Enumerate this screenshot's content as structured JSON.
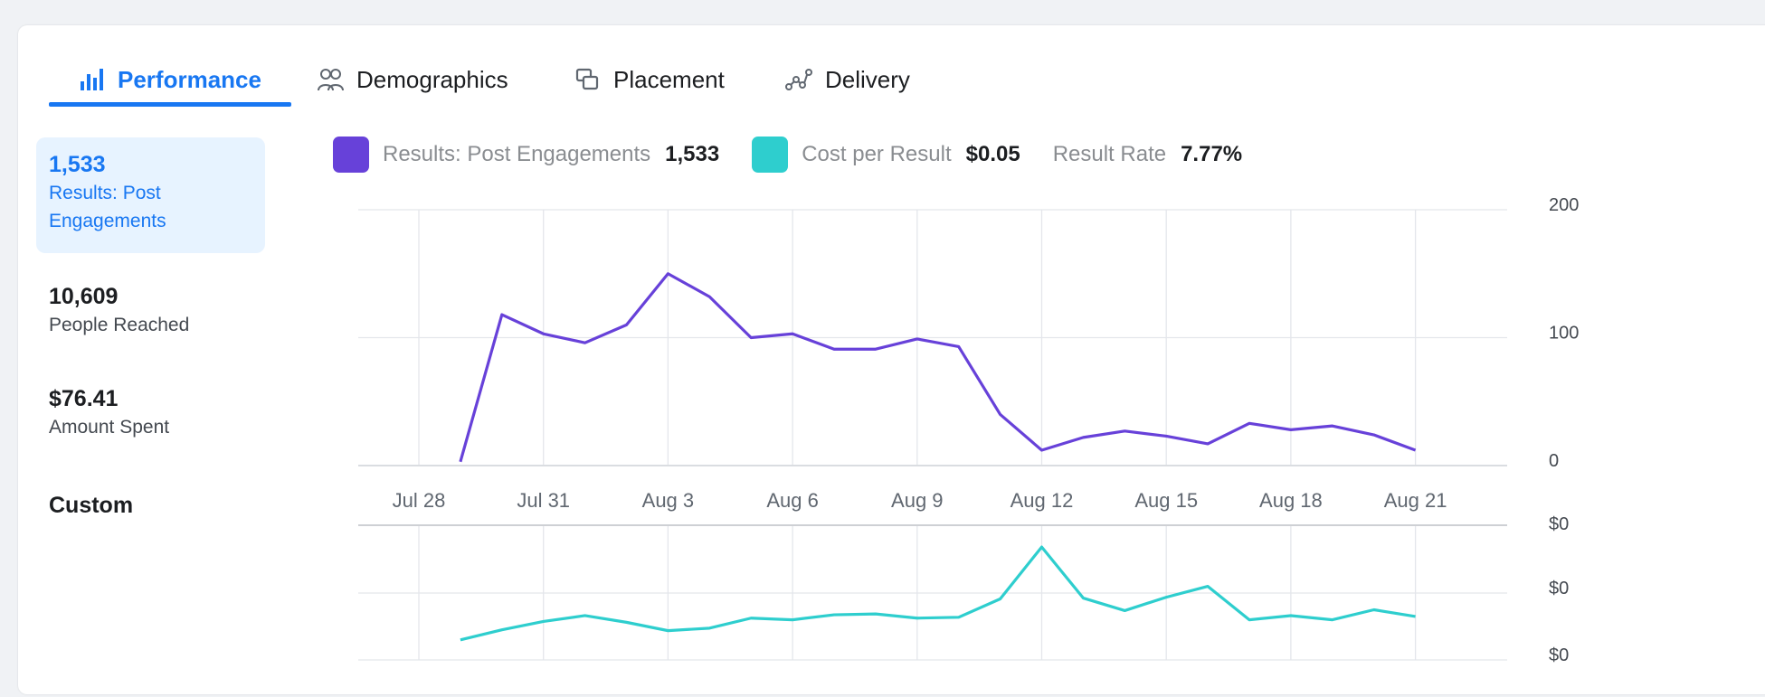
{
  "tabs": [
    {
      "label": "Performance",
      "icon": "bar-chart-icon",
      "active": true
    },
    {
      "label": "Demographics",
      "icon": "people-icon",
      "active": false
    },
    {
      "label": "Placement",
      "icon": "placement-icon",
      "active": false
    },
    {
      "label": "Delivery",
      "icon": "delivery-icon",
      "active": false
    }
  ],
  "metrics": [
    {
      "value": "1,533",
      "label_line1": "Results: Post",
      "label_line2": "Engagements",
      "selected": true
    },
    {
      "value": "10,609",
      "label": "People Reached"
    },
    {
      "value": "$76.41",
      "label": "Amount Spent"
    },
    {
      "value": "Custom"
    }
  ],
  "legend": {
    "results_label": "Results: Post Engagements",
    "results_value": "1,533",
    "cost_label": "Cost per Result",
    "cost_value": "$0.05",
    "rate_label": "Result Rate",
    "rate_value": "7.77%"
  },
  "colors": {
    "accent": "#1877f2",
    "results": "#6741d9",
    "cost": "#2ecece",
    "grid": "#e4e6eb"
  },
  "chart_data": [
    {
      "type": "line",
      "x": [
        "Jul 29",
        "Jul 30",
        "Jul 31",
        "Aug 1",
        "Aug 2",
        "Aug 3",
        "Aug 4",
        "Aug 5",
        "Aug 6",
        "Aug 7",
        "Aug 8",
        "Aug 9",
        "Aug 10",
        "Aug 11",
        "Aug 12",
        "Aug 13",
        "Aug 14",
        "Aug 15",
        "Aug 16",
        "Aug 17",
        "Aug 18",
        "Aug 19",
        "Aug 20",
        "Aug 21"
      ],
      "series": [
        {
          "name": "Results: Post Engagements",
          "color": "#6741d9",
          "values": [
            3,
            118,
            103,
            96,
            110,
            150,
            132,
            100,
            103,
            91,
            91,
            99,
            93,
            40,
            12,
            22,
            27,
            23,
            17,
            33,
            28,
            31,
            24,
            12
          ]
        }
      ],
      "xticks": [
        "Jul 28",
        "Jul 31",
        "Aug 3",
        "Aug 6",
        "Aug 9",
        "Aug 12",
        "Aug 15",
        "Aug 18",
        "Aug 21"
      ],
      "yticks": [
        "0",
        "100",
        "200"
      ],
      "ylim": [
        0,
        200
      ]
    },
    {
      "type": "line",
      "x": [
        "Jul 29",
        "Jul 30",
        "Jul 31",
        "Aug 1",
        "Aug 2",
        "Aug 3",
        "Aug 4",
        "Aug 5",
        "Aug 6",
        "Aug 7",
        "Aug 8",
        "Aug 9",
        "Aug 10",
        "Aug 11",
        "Aug 12",
        "Aug 13",
        "Aug 14",
        "Aug 15",
        "Aug 16",
        "Aug 17",
        "Aug 18",
        "Aug 19",
        "Aug 20",
        "Aug 21"
      ],
      "series": [
        {
          "name": "Cost per Result",
          "color": "#2ecece",
          "values": [
            0.024,
            0.036,
            0.046,
            0.053,
            0.045,
            0.035,
            0.038,
            0.05,
            0.048,
            0.054,
            0.055,
            0.05,
            0.051,
            0.073,
            0.135,
            0.074,
            0.059,
            0.075,
            0.088,
            0.048,
            0.053,
            0.048,
            0.06,
            0.052
          ]
        }
      ],
      "yticks": [
        "$0",
        "$0",
        "$0"
      ],
      "ylim": [
        0,
        0.16
      ]
    }
  ]
}
